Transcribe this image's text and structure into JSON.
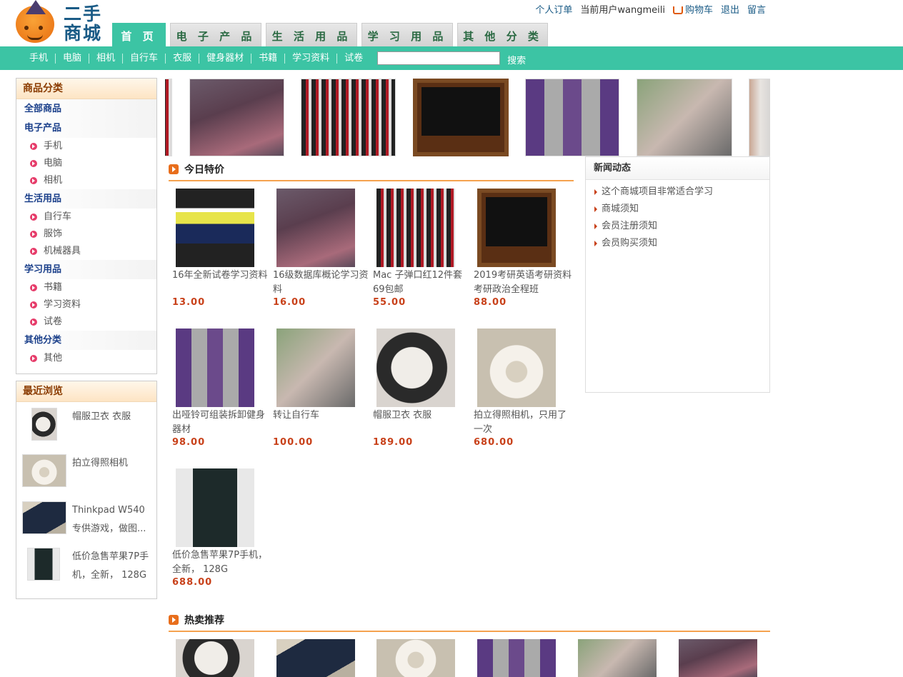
{
  "logo": {
    "text": "二手商城"
  },
  "toplinks": {
    "orders": "个人订单",
    "current_user": "当前用户wangmeili",
    "cart": "购物车",
    "logout": "退出",
    "message": "留言"
  },
  "main_tabs": [
    "首 页",
    "电 子 产 品",
    "生 活 用 品",
    "学 习 用 品",
    "其 他 分 类"
  ],
  "subnav": [
    "手机",
    "电脑",
    "相机",
    "自行车",
    "衣服",
    "健身器材",
    "书籍",
    "学习资料",
    "试卷"
  ],
  "search": {
    "button": "搜索",
    "value": ""
  },
  "categories": {
    "title": "商品分类",
    "all": "全部商品",
    "groups": [
      {
        "name": "电子产品",
        "items": [
          "手机",
          "电脑",
          "相机"
        ]
      },
      {
        "name": "生活用品",
        "items": [
          "自行车",
          "服饰",
          "机械器具"
        ]
      },
      {
        "name": "学习用品",
        "items": [
          "书籍",
          "学习资料",
          "试卷"
        ]
      },
      {
        "name": "其他分类",
        "items": [
          "其他"
        ]
      }
    ]
  },
  "recent": {
    "title": "最近浏览",
    "items": [
      "帽服卫衣 衣服",
      "拍立得照相机",
      "Thinkpad W540 专供游戏，做图...",
      "低价急售苹果7P手机，全新， 128G"
    ]
  },
  "today_special": {
    "title": "今日特价",
    "products": [
      {
        "name": "16年全新试卷学习资料",
        "price": "13.00"
      },
      {
        "name": "16级数据库概论学习资料",
        "price": "16.00"
      },
      {
        "name": "Mac 子弹口红12件套69包邮",
        "price": "55.00"
      },
      {
        "name": "2019考研英语考研资料考研政治全程班",
        "price": "88.00"
      },
      {
        "name": "出哑铃可组装拆卸健身器材",
        "price": "98.00"
      },
      {
        "name": "转让自行车",
        "price": "100.00"
      },
      {
        "name": "帽服卫衣 衣服",
        "price": "189.00"
      },
      {
        "name": "拍立得照相机，只用了一次",
        "price": "680.00"
      },
      {
        "name": "低价急售苹果7P手机，全新， 128G",
        "price": "688.00"
      }
    ]
  },
  "news": {
    "title": "新闻动态",
    "items": [
      "这个商城项目非常适合学习",
      "商城须知",
      "会员注册须知",
      "会员购买须知"
    ]
  },
  "hot": {
    "title": "热卖推荐"
  }
}
